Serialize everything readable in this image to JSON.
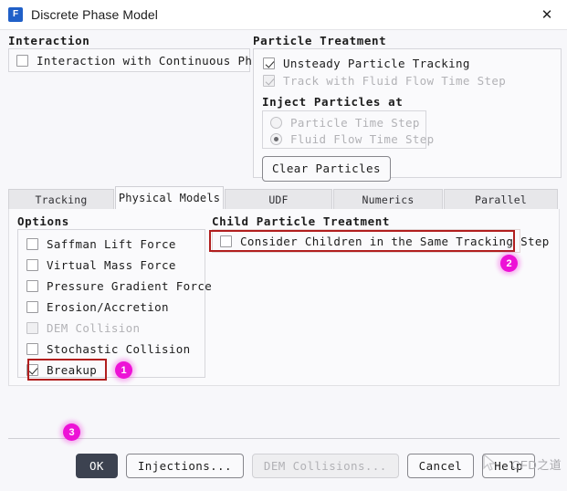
{
  "window": {
    "title": "Discrete Phase Model",
    "icon": "fluent-app-icon",
    "icon_letter": "F",
    "close_label": "✕"
  },
  "interaction": {
    "group_label": "Interaction",
    "checkbox_label": "Interaction with Continuous Phase",
    "checked": false,
    "enabled": true
  },
  "particle_treatment": {
    "group_label": "Particle Treatment",
    "options": [
      {
        "label": "Unsteady Particle Tracking",
        "checked": true,
        "enabled": true
      },
      {
        "label": "Track with Fluid Flow Time Step",
        "checked": true,
        "enabled": false
      }
    ],
    "inject_label": "Inject Particles at",
    "inject_options": [
      {
        "label": "Particle Time Step",
        "selected": false,
        "enabled": false
      },
      {
        "label": "Fluid Flow Time Step",
        "selected": true,
        "enabled": false
      }
    ],
    "clear_button": "Clear Particles"
  },
  "tabs": [
    {
      "label": "Tracking",
      "active": false
    },
    {
      "label": "Physical Models",
      "active": true
    },
    {
      "label": "UDF",
      "active": false
    },
    {
      "label": "Numerics",
      "active": false
    },
    {
      "label": "Parallel",
      "active": false
    }
  ],
  "options_group": {
    "group_label": "Options",
    "items": [
      {
        "label": "Saffman Lift Force",
        "checked": false,
        "enabled": true
      },
      {
        "label": "Virtual Mass Force",
        "checked": false,
        "enabled": true
      },
      {
        "label": "Pressure Gradient Force",
        "checked": false,
        "enabled": true
      },
      {
        "label": "Erosion/Accretion",
        "checked": false,
        "enabled": true
      },
      {
        "label": "DEM Collision",
        "checked": false,
        "enabled": false
      },
      {
        "label": "Stochastic Collision",
        "checked": false,
        "enabled": true
      },
      {
        "label": "Breakup",
        "checked": true,
        "enabled": true
      }
    ]
  },
  "child_particle_treatment": {
    "group_label": "Child Particle Treatment",
    "checkbox_label": "Consider Children in the Same Tracking Step",
    "checked": false,
    "enabled": true
  },
  "annotations": {
    "highlight_color": "#b11e1e",
    "badge_color": "#ed12d6",
    "badges": [
      {
        "number": "1",
        "target": "breakup-checkbox"
      },
      {
        "number": "2",
        "target": "consider-children-checkbox"
      },
      {
        "number": "3",
        "target": "ok-button"
      }
    ]
  },
  "footer": {
    "buttons": [
      {
        "label": "OK",
        "style": "primary",
        "enabled": true
      },
      {
        "label": "Injections...",
        "style": "normal",
        "enabled": true
      },
      {
        "label": "DEM Collisions...",
        "style": "disabled",
        "enabled": false
      },
      {
        "label": "Cancel",
        "style": "normal",
        "enabled": true
      },
      {
        "label": "Help",
        "style": "normal",
        "enabled": true
      }
    ]
  },
  "watermark": {
    "text": "CFD之道"
  }
}
